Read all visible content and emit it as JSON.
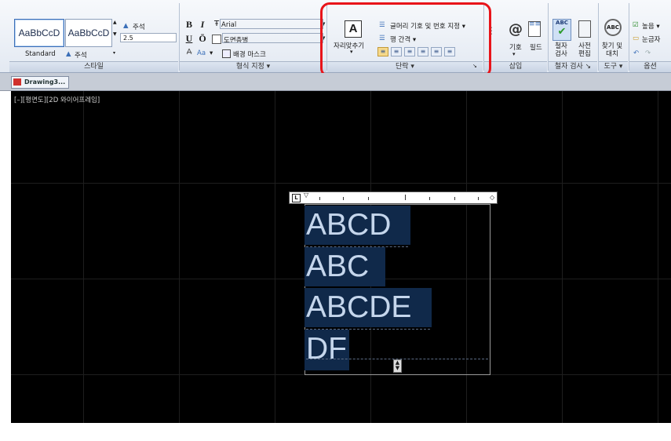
{
  "style_panel": {
    "style1": "AaBbCcD",
    "style2": "AaBbCcD",
    "style1_name": "Standard",
    "style2_name": "주석",
    "annotation_label": "주석",
    "height_value": "2.5",
    "title": "스타일"
  },
  "format_panel": {
    "bold": "B",
    "italic": "I",
    "font_name": "Arial",
    "underline": "U",
    "overline": "Ō",
    "color_value": "도면층별",
    "case_label": "Aa",
    "background_mask": "배경 마스크",
    "title": "형식 지정 ▾"
  },
  "paragraph_panel": {
    "justify_label": "자리맞추기",
    "bullets": "글머리 기호 및 번호 지정 ▾",
    "line_spacing": "행 간격 ▾",
    "align_buttons": [
      "≡",
      "≡",
      "≡",
      "≡",
      "≡",
      "≡"
    ],
    "title": "단락 ▾",
    "expand": "↘"
  },
  "insert_panel": {
    "symbol": "기호",
    "field": "필드",
    "title": "삽입"
  },
  "spell_panel": {
    "spell_check": "철자 검사",
    "edit_dict": "사전 편집",
    "title": "철자 검사 ↘"
  },
  "tools_panel": {
    "find_replace": "찾기 및 대치",
    "title": "도구 ▾"
  },
  "options_panel": {
    "more": "높음 ▾",
    "ruler": "눈금자",
    "title": "옵션"
  },
  "document_tab": "Drawing3...",
  "viewport_label": "[–][평면도][2D 와이어프레임]",
  "text_lines": [
    "ABCD",
    "ABC",
    "ABCDE",
    "DF"
  ],
  "ruler_indicator": "L",
  "colors": {
    "highlight": "#e8141a",
    "canvas": "#000000",
    "text_selection": "#10294a",
    "text_color": "#c5d6ec"
  }
}
